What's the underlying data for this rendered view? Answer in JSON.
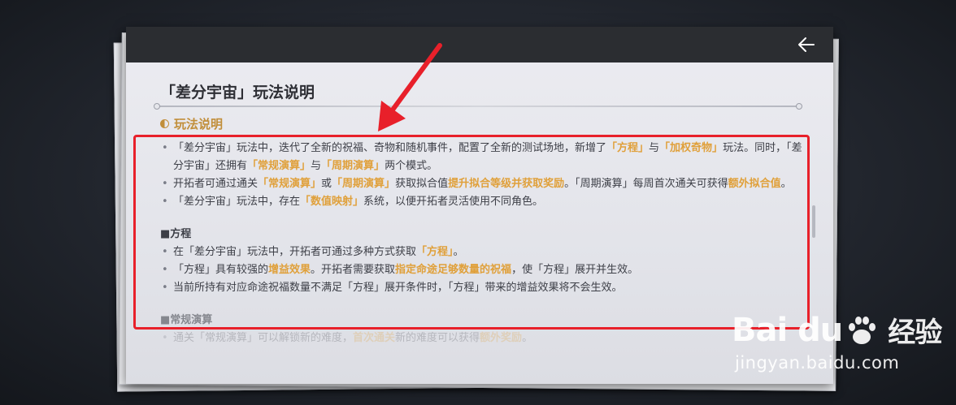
{
  "header": {
    "back_icon": "back-arrow-icon"
  },
  "title": "「差分宇宙」玩法说明",
  "section": {
    "heading": "玩法说明",
    "icon": "half-circle-icon"
  },
  "content": {
    "p1": [
      {
        "t": "「差分宇宙」玩法中，迭代了全新的祝福、奇物和随机事件，配置了全新的测试场地，新增了",
        "h": false
      },
      {
        "t": "「方程」",
        "h": true
      },
      {
        "t": "与",
        "h": false
      },
      {
        "t": "「加权奇物」",
        "h": true
      },
      {
        "t": "玩法。同时，「差分宇宙」还拥有",
        "h": false
      },
      {
        "t": "「常规演算」",
        "h": true
      },
      {
        "t": "与",
        "h": false
      },
      {
        "t": "「周期演算」",
        "h": true
      },
      {
        "t": "两个模式。",
        "h": false
      }
    ],
    "p2": [
      {
        "t": "开拓者可通过通关",
        "h": false
      },
      {
        "t": "「常规演算」",
        "h": true
      },
      {
        "t": "或",
        "h": false
      },
      {
        "t": "「周期演算」",
        "h": true
      },
      {
        "t": "获取拟合值",
        "h": false
      },
      {
        "t": "提升拟合等级并获取奖励",
        "h": true
      },
      {
        "t": "。「周期演算」每周首次通关可获得",
        "h": false
      },
      {
        "t": "额外拟合值",
        "h": true
      },
      {
        "t": "。",
        "h": false
      }
    ],
    "p3": [
      {
        "t": "「差分宇宙」玩法中，存在",
        "h": false
      },
      {
        "t": "「数值映射」",
        "h": true
      },
      {
        "t": "系统，以便开拓者灵活使用不同角色。",
        "h": false
      }
    ],
    "sub1": "■方程",
    "p4": [
      {
        "t": "在「差分宇宙」玩法中，开拓者可通过多种方式获取",
        "h": false
      },
      {
        "t": "「方程」",
        "h": true
      },
      {
        "t": "。",
        "h": false
      }
    ],
    "p5": [
      {
        "t": "「方程」具有较强的",
        "h": false
      },
      {
        "t": "增益效果",
        "h": true
      },
      {
        "t": "。开拓者需要获取",
        "h": false
      },
      {
        "t": "指定命途足够数量的祝福",
        "h": true
      },
      {
        "t": "，使「方程」展开并生效。",
        "h": false
      }
    ],
    "p6": [
      {
        "t": "当前所持有对应命途祝福数量不满足「方程」展开条件时，「方程」带来的增益效果将不会生效。",
        "h": false
      }
    ],
    "sub2": "■常规演算",
    "p7": [
      {
        "t": "通关「常规演算」可以解锁新的难度，",
        "h": false
      },
      {
        "t": "首次通关",
        "h": true
      },
      {
        "t": "新的难度可以获得",
        "h": false
      },
      {
        "t": "额外奖励",
        "h": true
      },
      {
        "t": "。",
        "h": false
      }
    ]
  },
  "annotation": {
    "box_color": "#e8202a",
    "arrow_color": "#e8202a"
  },
  "watermark": {
    "logo": "Bai du",
    "cn": "经验",
    "url": "jingyan.baidu.com"
  },
  "colors": {
    "highlight": "#e0a03a",
    "section": "#c18e3a",
    "topbar": "#2b2d31"
  }
}
